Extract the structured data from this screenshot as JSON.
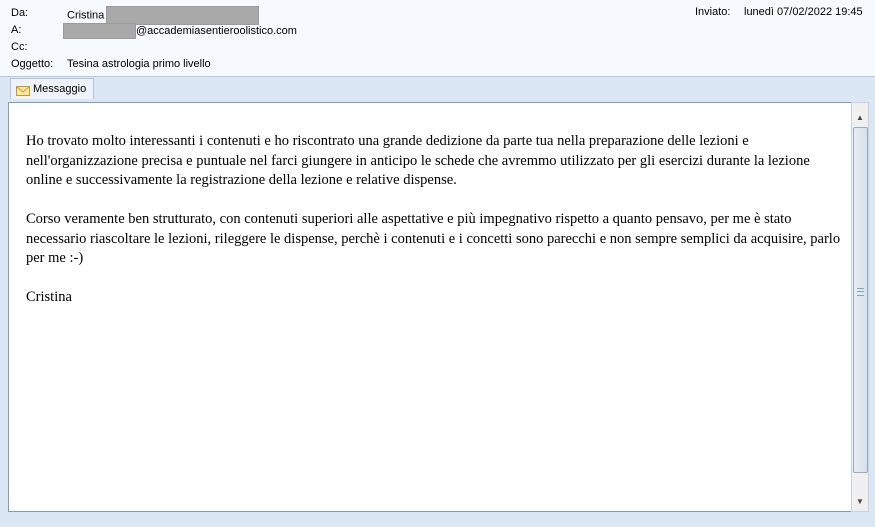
{
  "header": {
    "from_label": "Da:",
    "from_name": "Cristina",
    "to_label": "A:",
    "to_address": "@accademiasentieroolistico.com",
    "cc_label": "Cc:",
    "subject_label": "Oggetto:",
    "subject": "Tesina astrologia primo livello",
    "sent_label": "Inviato:",
    "sent_value": "lunedì 07/02/2022 19:45"
  },
  "tabs": [
    {
      "label": "Messaggio",
      "icon": "envelope-icon"
    }
  ],
  "message": {
    "paragraphs": [
      "Ho trovato molto interessanti i contenuti e ho riscontrato una grande dedizione da parte tua nella preparazione delle lezioni e nell'organizzazione precisa e puntuale nel farci giungere in anticipo le schede che avremmo utilizzato per gli esercizi durante la lezione online e successivamente la registrazione della lezione e relative dispense.",
      "Corso veramente ben strutturato, con contenuti superiori alle aspettative e più impegnativo rispetto a quanto pensavo, per me è stato necessario riascoltare le lezioni, rileggere le dispense, perchè i contenuti e i concetti sono parecchi e non sempre semplici da acquisire, parlo per me :-)",
      "Cristina"
    ]
  },
  "colors": {
    "header_bg": "#f6f9fd",
    "frame_bg": "#dbe7f5",
    "redaction": "#a9a9a9"
  }
}
